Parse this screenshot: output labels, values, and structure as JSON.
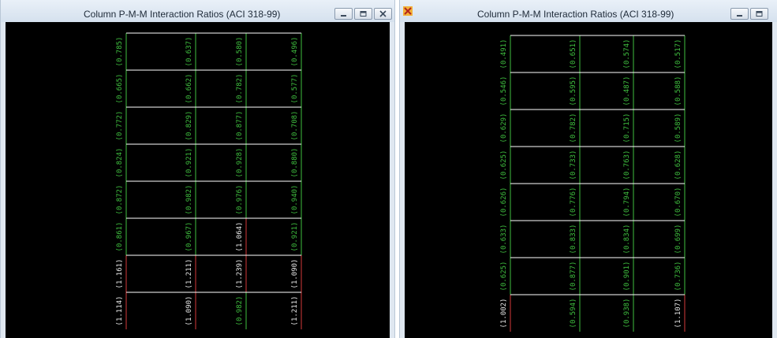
{
  "windows": [
    {
      "id": "left",
      "title": "Column P-M-M Interaction Ratios  (ACI 318-99)",
      "controls": [
        "minimize",
        "maximize",
        "close"
      ],
      "ratios": [
        [
          "0.785",
          "0.637",
          "0.580",
          "0.496"
        ],
        [
          "0.665",
          "0.662",
          "0.782",
          "0.577"
        ],
        [
          "0.772",
          "0.829",
          "0.877",
          "0.708"
        ],
        [
          "0.824",
          "0.921",
          "0.928",
          "0.880"
        ],
        [
          "0.872",
          "0.982",
          "0.976",
          "0.940"
        ],
        [
          "0.861",
          "0.967",
          "1.064",
          "0.921"
        ],
        [
          "1.161",
          "1.211",
          "1.239",
          "1.090"
        ],
        [
          "1.114",
          "1.090",
          "0.982",
          "1.211"
        ]
      ],
      "overstressed": [
        [
          false,
          false,
          false,
          false
        ],
        [
          false,
          false,
          false,
          false
        ],
        [
          false,
          false,
          false,
          false
        ],
        [
          false,
          false,
          false,
          false
        ],
        [
          false,
          false,
          false,
          false
        ],
        [
          false,
          false,
          true,
          false
        ],
        [
          true,
          true,
          true,
          true
        ],
        [
          true,
          true,
          false,
          true
        ]
      ]
    },
    {
      "id": "right",
      "title": "Column P-M-M Interaction Ratios  (ACI 318-99)",
      "controls": [
        "minimize",
        "maximize"
      ],
      "ratios": [
        [
          "0.491",
          "0.651",
          "0.574",
          "0.517"
        ],
        [
          "0.546",
          "0.595",
          "0.487",
          "0.588"
        ],
        [
          "0.629",
          "0.782",
          "0.715",
          "0.589"
        ],
        [
          "0.625",
          "0.733",
          "0.763",
          "0.628"
        ],
        [
          "0.626",
          "0.776",
          "0.794",
          "0.670"
        ],
        [
          "0.633",
          "0.833",
          "0.834",
          "0.699"
        ],
        [
          "0.625",
          "0.877",
          "0.901",
          "0.736"
        ],
        [
          "1.002",
          "0.594",
          "0.938",
          "1.107"
        ]
      ],
      "overstressed": [
        [
          false,
          false,
          false,
          false
        ],
        [
          false,
          false,
          false,
          false
        ],
        [
          false,
          false,
          false,
          false
        ],
        [
          false,
          false,
          false,
          false
        ],
        [
          false,
          false,
          false,
          false
        ],
        [
          false,
          false,
          false,
          false
        ],
        [
          false,
          false,
          false,
          false
        ],
        [
          true,
          false,
          false,
          true
        ]
      ]
    }
  ],
  "colors": {
    "canvas": "#000000",
    "beam": "#ffffff",
    "column_ok": "#3fbf3f",
    "column_over": "#d43a3a",
    "label_ok": "#3fbf3f",
    "label_over": "#e8e8e8"
  },
  "icons": [
    "sap2000-app-icon",
    "minimize-icon",
    "maximize-icon",
    "close-icon"
  ]
}
